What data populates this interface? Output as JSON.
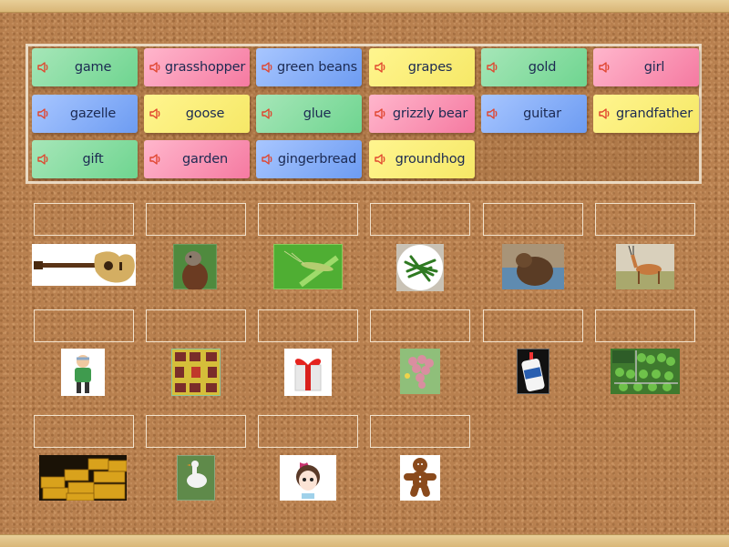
{
  "word_bank": [
    {
      "label": "game",
      "color": "green"
    },
    {
      "label": "grasshopper",
      "color": "pink"
    },
    {
      "label": "green beans",
      "color": "blue"
    },
    {
      "label": "grapes",
      "color": "yellow"
    },
    {
      "label": "gold",
      "color": "green"
    },
    {
      "label": "girl",
      "color": "pink"
    },
    {
      "label": "gazelle",
      "color": "blue"
    },
    {
      "label": "goose",
      "color": "yellow"
    },
    {
      "label": "glue",
      "color": "green"
    },
    {
      "label": "grizzly bear",
      "color": "pink"
    },
    {
      "label": "guitar",
      "color": "blue"
    },
    {
      "label": "grandfather",
      "color": "yellow"
    },
    {
      "label": "gift",
      "color": "green"
    },
    {
      "label": "garden",
      "color": "pink"
    },
    {
      "label": "gingerbread",
      "color": "blue"
    },
    {
      "label": "groundhog",
      "color": "yellow"
    }
  ],
  "drop_targets": [
    {
      "picture": "guitar-image",
      "answer": ""
    },
    {
      "picture": "groundhog-image",
      "answer": ""
    },
    {
      "picture": "grasshopper-image",
      "answer": ""
    },
    {
      "picture": "green-beans-image",
      "answer": ""
    },
    {
      "picture": "grizzly-bear-image",
      "answer": ""
    },
    {
      "picture": "gazelle-image",
      "answer": ""
    },
    {
      "picture": "grandfather-image",
      "answer": ""
    },
    {
      "picture": "game-image",
      "answer": ""
    },
    {
      "picture": "gift-image",
      "answer": ""
    },
    {
      "picture": "grapes-image",
      "answer": ""
    },
    {
      "picture": "glue-image",
      "answer": ""
    },
    {
      "picture": "garden-image",
      "answer": ""
    },
    {
      "picture": "gold-image",
      "answer": ""
    },
    {
      "picture": "goose-image",
      "answer": ""
    },
    {
      "picture": "girl-image",
      "answer": ""
    },
    {
      "picture": "gingerbread-image",
      "answer": ""
    }
  ],
  "icons": {
    "card_audio": "speaker-icon"
  },
  "colors": {
    "green": "#7ddb9b",
    "pink": "#f78fb0",
    "blue": "#7fa9f5",
    "yellow": "#f8ec72",
    "speaker": "#e0452e",
    "card_text": "#1c2a52",
    "slot_border": "#f2e2cc"
  }
}
